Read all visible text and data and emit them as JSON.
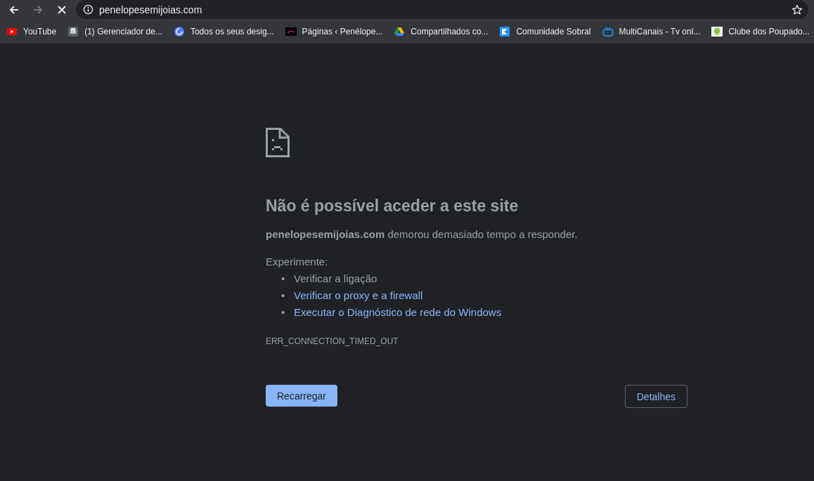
{
  "toolbar": {
    "nav": [
      {
        "kind": "back",
        "disabled": false
      },
      {
        "kind": "forward",
        "disabled": true
      },
      {
        "kind": "stop",
        "disabled": false
      }
    ],
    "address": "penelopesemijoias.com"
  },
  "bookmarks": [
    {
      "label": "YouTube"
    },
    {
      "label": "(1) Gerenciador de..."
    },
    {
      "label": "Todos os seus desig..."
    },
    {
      "label": "Páginas ‹ Penélope..."
    },
    {
      "label": "Compartilhados co..."
    },
    {
      "label": "Comunidade Sobral"
    },
    {
      "label": "MultiCanais - Tv onl..."
    },
    {
      "label": "Clube dos Poupado..."
    }
  ],
  "error": {
    "title": "Não é possível aceder a este site",
    "message": "**penelopesemijoias.com** demorou demasiado tempo a responder.",
    "try_label": "Experimente:",
    "suggestions": [
      {
        "kind": "text",
        "bullet": "•",
        "text": "Verificar a ligação"
      },
      {
        "kind": "link",
        "bullet": "•",
        "text": "Verificar o proxy e a firewall"
      },
      {
        "kind": "link",
        "bullet": "•",
        "text": "Executar o Diagnóstico de rede do Windows"
      }
    ],
    "code": "ERR_CONNECTION_TIMED_OUT",
    "reload_button": "Recarregar",
    "details_button": "Detalhes"
  }
}
